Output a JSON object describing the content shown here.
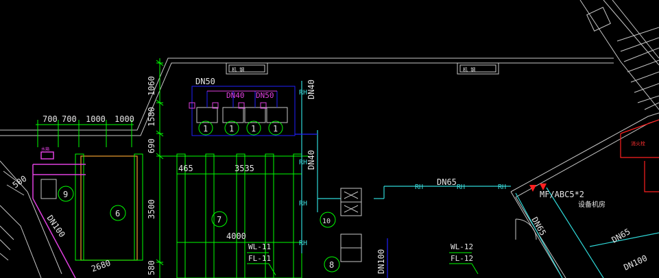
{
  "labels": {
    "dims_top": [
      "700",
      "700",
      "1000",
      "1000"
    ],
    "dims_vertical": [
      "1060",
      "1580",
      "690",
      "3500",
      "580"
    ],
    "dim_465": "465",
    "dim_3535": "3535",
    "dim_4000": "4000",
    "dim_500": "500",
    "dim_2680": "2680",
    "dn50_top": "DN50",
    "dn40_a": "DN40",
    "dn50_b": "DN50",
    "dn40_riser1": "DN40",
    "dn40_riser2": "DN40",
    "dn65_main": "DN65",
    "dn65_diag": "DN65",
    "dn65_right": "DN65",
    "dn100_left": "DN100",
    "dn100_mid": "DN100",
    "dn100_right": "DN100",
    "rh": "RH",
    "extinguisher": "MF/ABC5*2",
    "room_name": "设备机房",
    "wl11": "WL-11",
    "fl11": "FL-11",
    "wl12": "WL-12",
    "fl12": "FL-12",
    "circle_1": "1",
    "circle_6": "6",
    "circle_7": "7",
    "circle_9": "9",
    "circle_10": "10",
    "circle_8": "8",
    "circle_1_b": "1",
    "plate_a": "机 钢",
    "plate_b": "机 钢",
    "small_red": "消火栓",
    "small_mag": "水箱"
  },
  "colors": {
    "wall": "#c8c8c8",
    "dim_green": "#00ff00",
    "cyan_pipe": "#2fd8d8",
    "blue_pipe": "#2020ff",
    "magenta": "#e040e0",
    "orange": "#f0a030",
    "red": "#ff2020"
  }
}
